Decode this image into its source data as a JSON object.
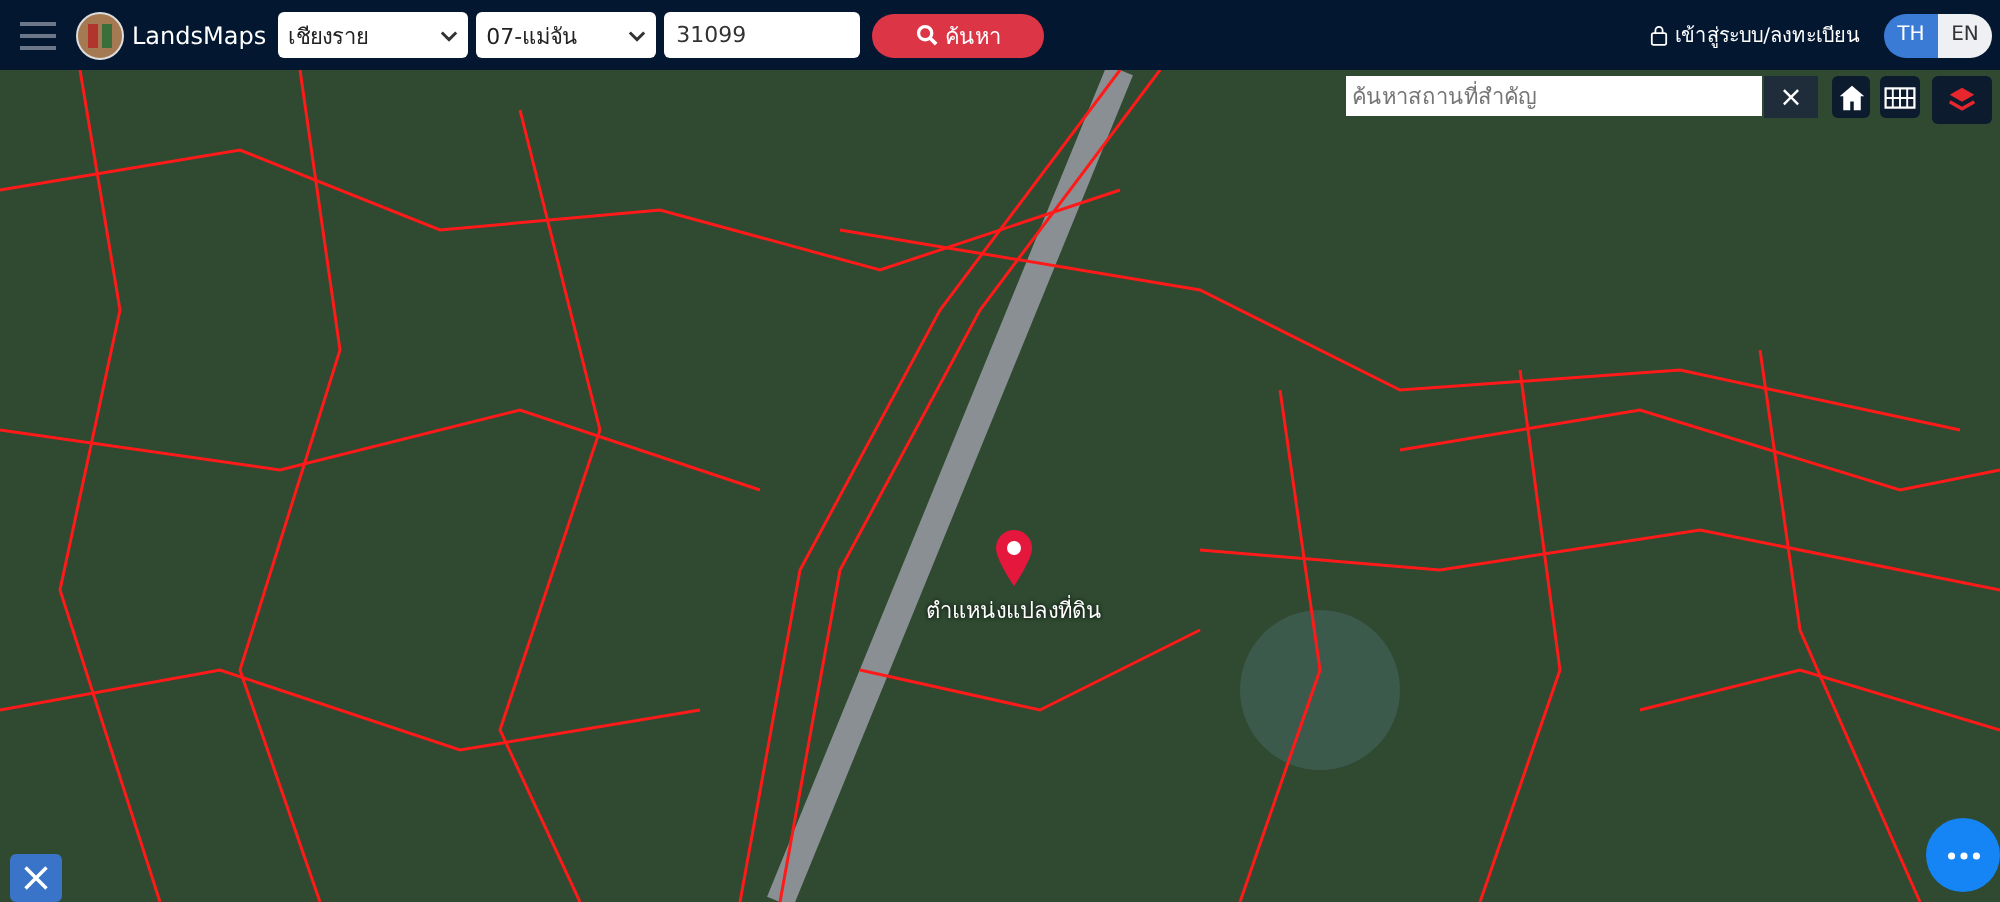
{
  "header": {
    "logo_text": "LandsMaps",
    "province": {
      "value": "เชียงราย"
    },
    "district": {
      "value": "07-แม่จัน"
    },
    "parcel_number": {
      "value": "31099"
    },
    "search_button": "ค้นหา",
    "login_link": "เข้าสู่ระบบ/ลงทะเบียน",
    "languages": [
      {
        "label": "TH",
        "selected": true
      },
      {
        "label": "EN",
        "selected": false
      }
    ]
  },
  "map": {
    "place_search": {
      "placeholder": "ค้นหาสถานที่สำคัญ"
    },
    "clear_button": "×",
    "pin_label": "ตำแหน่งแปลงที่ดิน"
  }
}
